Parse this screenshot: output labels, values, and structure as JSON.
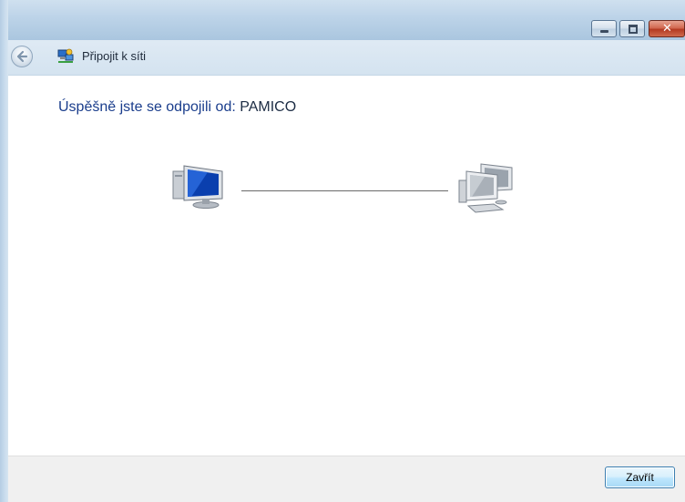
{
  "window": {
    "title": "Připojit k síti",
    "controls": {
      "minimize_icon": "minimize-icon",
      "maximize_icon": "maximize-icon",
      "close_icon": "close-icon",
      "close_glyph": "✕"
    }
  },
  "main": {
    "heading_prefix": "Úspěšně jste se odpojili od: ",
    "network_name": "PAMICO",
    "left_computer_icon": "computer-icon",
    "right_network_icon": "network-computers-icon"
  },
  "footer": {
    "close_label": "Zavřít"
  },
  "colors": {
    "heading": "#1a3d8c",
    "close_button_border": "#3c7fb1",
    "frame": "#bcd3e8"
  }
}
